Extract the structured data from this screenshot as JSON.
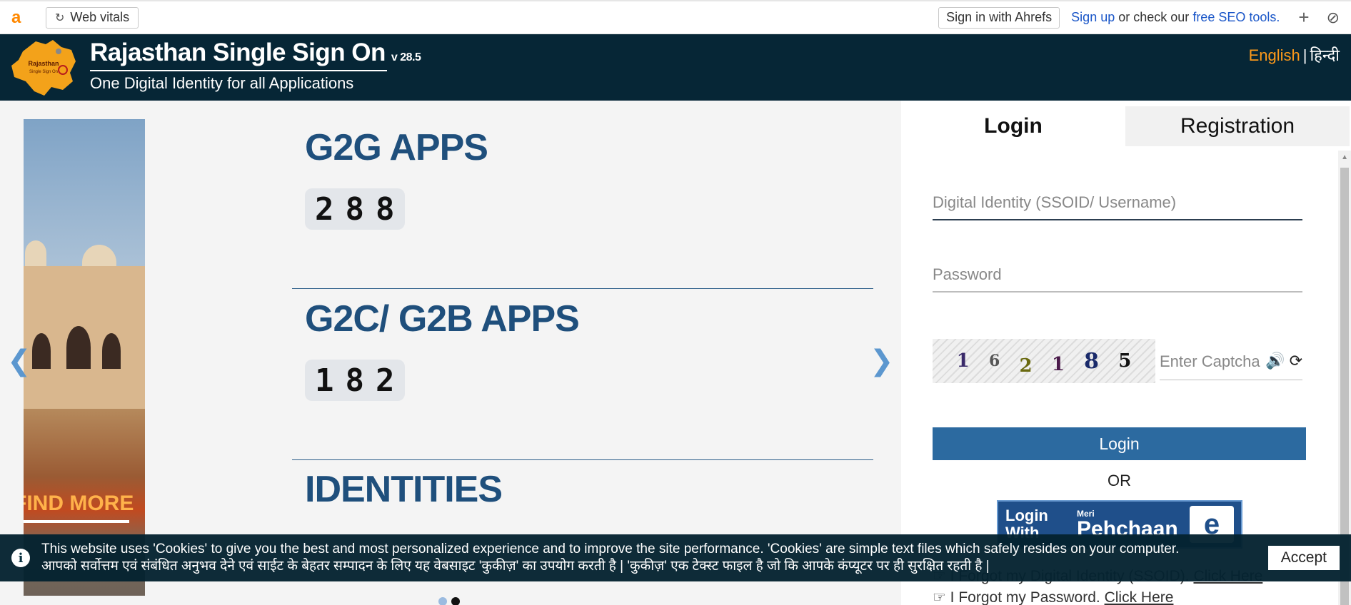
{
  "ahrefs": {
    "logo": "a",
    "web_vitals": "Web vitals",
    "sign_in": "Sign in with Ahrefs",
    "sign_up": "Sign up",
    "middle": "or check our",
    "free_tools": "free SEO tools.",
    "plus": "+",
    "ban": "⊘"
  },
  "header": {
    "title": "Rajasthan Single Sign On",
    "version": "v 28.5",
    "subtitle": "One Digital Identity for all Applications",
    "lang_english": "English",
    "lang_separator": "|",
    "lang_hindi": "हिन्दी",
    "emblem_text_top": "Rajasthan",
    "emblem_text_bottom": "Single Sign On"
  },
  "carousel": {
    "find_more": "FIND MORE",
    "prev": "❮",
    "next": "❯"
  },
  "stats": [
    {
      "title": "G2G APPS",
      "digits": [
        "2",
        "8",
        "8"
      ]
    },
    {
      "title": "G2C/ G2B APPS",
      "digits": [
        "1",
        "8",
        "2"
      ]
    },
    {
      "title": "IDENTITIES",
      "digits": [
        "",
        "",
        ""
      ]
    }
  ],
  "login": {
    "tab_login": "Login",
    "tab_registration": "Registration",
    "ssoid_placeholder": "Digital Identity (SSOID/ Username)",
    "password_placeholder": "Password",
    "captcha_digits": [
      "1",
      "6",
      "2",
      "1",
      "8",
      "5"
    ],
    "captcha_placeholder": "Enter Captcha",
    "login_button": "Login",
    "or": "OR",
    "pehchaan_left": "Login With",
    "pehchaan_small": "Meri",
    "pehchaan_big": "Pehchaan",
    "pehchaan_logo": "e",
    "forgot_ssoid_text": "I Forgot my Digital Identity (SSOID).",
    "forgot_ssoid_link": "Click Here",
    "forgot_password_text": "I Forgot my Password.",
    "forgot_password_link": "Click Here"
  },
  "cookie": {
    "line_en": "This website uses 'Cookies' to give you the best and most personalized experience and to improve the site performance. 'Cookies' are simple text files which safely resides on your computer.",
    "line_hi": "आपको सर्वोत्तम एवं संबंधित अनुभव देने एवं साईट के बेहतर सम्पादन के लिए यह वेबसाइट 'कुकीज़' का उपयोग करती है | 'कुकीज़' एक टेक्स्ट फाइल है जो कि आपके कंप्यूटर पर ही सुरक्षित रहती है |",
    "accept": "Accept",
    "info_icon": "i"
  },
  "colors": {
    "header_bg": "#062636",
    "accent_blue": "#2c6aa0",
    "title_blue": "#1f4f7c",
    "lang_orange": "#ff9a1a"
  }
}
